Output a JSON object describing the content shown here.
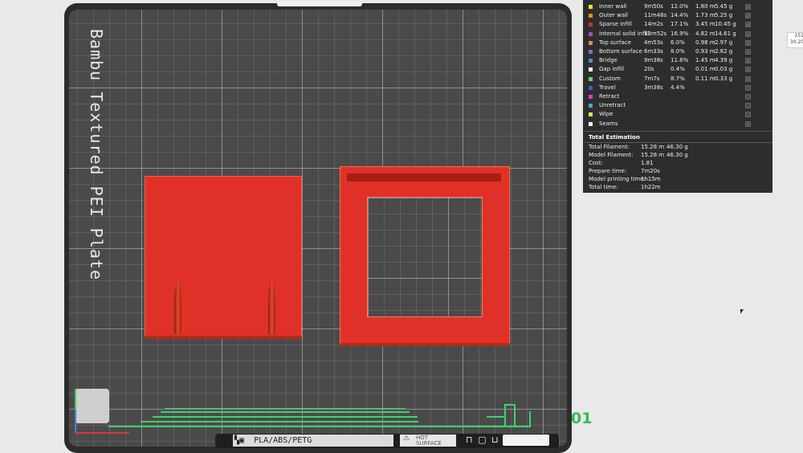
{
  "plate": {
    "title": "Bambu Textured PEI Plate",
    "index": "01"
  },
  "bottom_bar": {
    "filament_label": "PLA/ABS/PETG",
    "hot_surface_line1": "HOT",
    "hot_surface_line2": "SURFACE"
  },
  "legend": {
    "rows": [
      {
        "name": "Inner wall",
        "time": "9m50s",
        "percent": "12.0%",
        "length": "1.80 m",
        "weight": "5.45 g",
        "color": "#f2df3a",
        "checked": true
      },
      {
        "name": "Outer wall",
        "time": "11m48s",
        "percent": "14.4%",
        "length": "1.73 m",
        "weight": "5.25 g",
        "color": "#f08a1a",
        "checked": true
      },
      {
        "name": "Sparse infill",
        "time": "14m2s",
        "percent": "17.1%",
        "length": "3.45 m",
        "weight": "10.45 g",
        "color": "#c2363a",
        "checked": true
      },
      {
        "name": "Internal solid infill",
        "time": "13m52s",
        "percent": "16.9%",
        "length": "4.82 m",
        "weight": "14.61 g",
        "color": "#a24cc0",
        "checked": true
      },
      {
        "name": "Top surface",
        "time": "4m53s",
        "percent": "6.0%",
        "length": "0.98 m",
        "weight": "2.97 g",
        "color": "#f07a5a",
        "checked": true
      },
      {
        "name": "Bottom surface",
        "time": "6m33s",
        "percent": "8.0%",
        "length": "0.93 m",
        "weight": "2.82 g",
        "color": "#7a70d0",
        "checked": true
      },
      {
        "name": "Bridge",
        "time": "9m38s",
        "percent": "11.8%",
        "length": "1.45 m",
        "weight": "4.39 g",
        "color": "#5a8ad0",
        "checked": true
      },
      {
        "name": "Gap infill",
        "time": "20s",
        "percent": "0.4%",
        "length": "0.01 m",
        "weight": "0.03 g",
        "color": "#ffffff",
        "checked": true
      },
      {
        "name": "Custom",
        "time": "7m7s",
        "percent": "8.7%",
        "length": "0.11 m",
        "weight": "0.33 g",
        "color": "#6fce6f",
        "checked": true
      },
      {
        "name": "Travel",
        "time": "3m38s",
        "percent": "4.4%",
        "length": "",
        "weight": "",
        "color": "#3a5ad0",
        "checked": false
      },
      {
        "name": "Retract",
        "time": "",
        "percent": "",
        "length": "",
        "weight": "",
        "color": "#d040c0",
        "checked": false
      },
      {
        "name": "Unretract",
        "time": "",
        "percent": "",
        "length": "",
        "weight": "",
        "color": "#50a0d8",
        "checked": false
      },
      {
        "name": "Wipe",
        "time": "",
        "percent": "",
        "length": "",
        "weight": "",
        "color": "#f2e23a",
        "checked": false
      },
      {
        "name": "Seams",
        "time": "",
        "percent": "",
        "length": "",
        "weight": "",
        "color": "#f0f0f0",
        "checked": true
      }
    ]
  },
  "totals": {
    "title": "Total Estimation",
    "rows": [
      {
        "label": "Total Filament:",
        "a": "15.28 m",
        "b": "46.30 g"
      },
      {
        "label": "Model Filament:",
        "a": "15.28 m",
        "b": "46.30 g"
      },
      {
        "label": "Cost:",
        "a": "1.81",
        "b": ""
      },
      {
        "label": "Prepare time:",
        "a": "7m20s",
        "b": ""
      },
      {
        "label": "Model printing time:",
        "a": "1h15m",
        "b": ""
      },
      {
        "label": "Total time:",
        "a": "1h22m",
        "b": ""
      }
    ]
  },
  "side_box": {
    "line1": "151",
    "line2": "30.20"
  }
}
